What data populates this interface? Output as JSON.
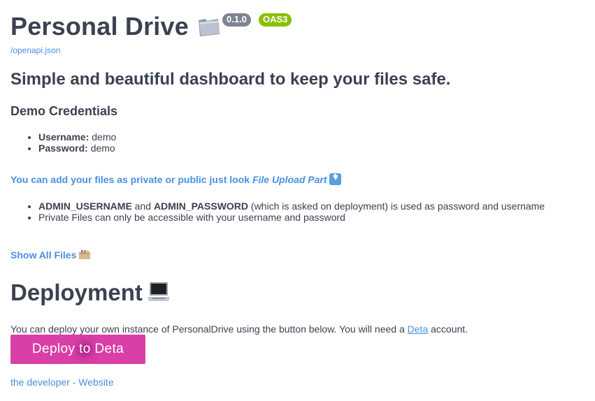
{
  "info": {
    "title": "Personal Drive",
    "version_badge": "0.1.0",
    "oas_badge": "OAS3",
    "spec_link": "/openapi.json"
  },
  "description": {
    "tagline": "Simple and beautiful dashboard to keep your files safe.",
    "credentials_heading": "Demo Credentials",
    "credentials": [
      {
        "label": "Username:",
        "value": " demo"
      },
      {
        "label": "Password:",
        "value": " demo"
      }
    ],
    "upload_link_text": "You can add your files as private or public just look ",
    "upload_link_em": "File Upload Part",
    "rules": [
      {
        "strong1": "ADMIN_USERNAME",
        "mid": " and ",
        "strong2": "ADMIN_PASSWORD",
        "rest": " (which is asked on deployment) is used as password and username"
      },
      {
        "text": "Private Files can only be accessible with your username and password"
      }
    ],
    "show_files_link": "Show All Files",
    "deployment_heading": "Deployment",
    "deployment_text_before": "You can deploy your own instance of PersonalDrive using the button below. You will need a ",
    "deployment_link": "Deta",
    "deployment_text_after": " account.",
    "deploy_button": "Deploy to Deta",
    "developer_link": "the developer - Website"
  },
  "colors": {
    "link": "#4990e2",
    "heading": "#3b4151",
    "version_badge_bg": "#7d8492",
    "oas_badge_bg": "#89bf04",
    "deploy_button_bg": "#d93fa6"
  },
  "icons": [
    "file-folder-icon",
    "down-arrow-icon",
    "box-icon",
    "laptop-icon"
  ]
}
